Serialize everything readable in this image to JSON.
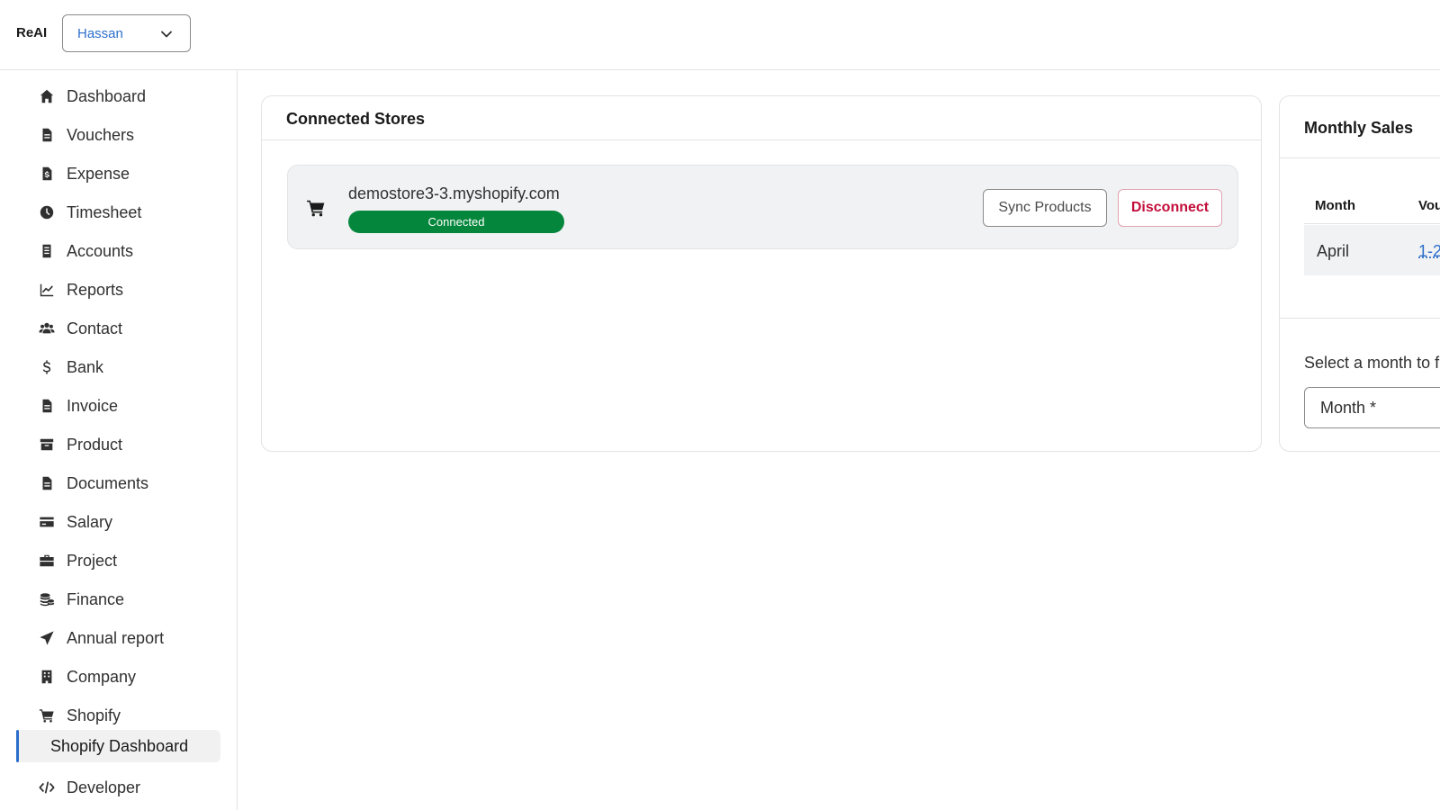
{
  "header": {
    "brand": "ReAI",
    "org_select": {
      "value": "Hassan"
    }
  },
  "sidebar": {
    "items": [
      {
        "label": "Dashboard",
        "icon": "home-icon"
      },
      {
        "label": "Vouchers",
        "icon": "document-icon"
      },
      {
        "label": "Expense",
        "icon": "receipt-dollar-icon"
      },
      {
        "label": "Timesheet",
        "icon": "clock-icon"
      },
      {
        "label": "Accounts",
        "icon": "ledger-icon"
      },
      {
        "label": "Reports",
        "icon": "line-chart-icon"
      },
      {
        "label": "Contact",
        "icon": "users-icon"
      },
      {
        "label": "Bank",
        "icon": "dollar-icon"
      },
      {
        "label": "Invoice",
        "icon": "invoice-icon"
      },
      {
        "label": "Product",
        "icon": "archive-icon"
      },
      {
        "label": "Documents",
        "icon": "file-icon"
      },
      {
        "label": "Salary",
        "icon": "credit-card-icon"
      },
      {
        "label": "Project",
        "icon": "briefcase-icon"
      },
      {
        "label": "Finance",
        "icon": "coins-icon"
      },
      {
        "label": "Annual report",
        "icon": "paper-plane-icon"
      },
      {
        "label": "Company",
        "icon": "building-icon"
      },
      {
        "label": "Shopify",
        "icon": "cart-icon"
      },
      {
        "label": "Developer",
        "icon": "code-icon"
      }
    ],
    "active_subitem": "Shopify Dashboard"
  },
  "stores_card": {
    "title": "Connected Stores",
    "store": {
      "name": "demostore3-3.myshopify.com",
      "status": "Connected",
      "sync_label": "Sync Products",
      "disconnect_label": "Disconnect"
    }
  },
  "sales_card": {
    "title": "Monthly Sales",
    "columns": [
      "Month",
      "Vou"
    ],
    "rows": [
      {
        "month": "April",
        "voucher": "1-2"
      }
    ],
    "select_text": "Select a month to f",
    "month_field": "Month *"
  },
  "colors": {
    "accent": "#2c6ecb",
    "success": "#04873c",
    "critical": "#c20e3a"
  }
}
